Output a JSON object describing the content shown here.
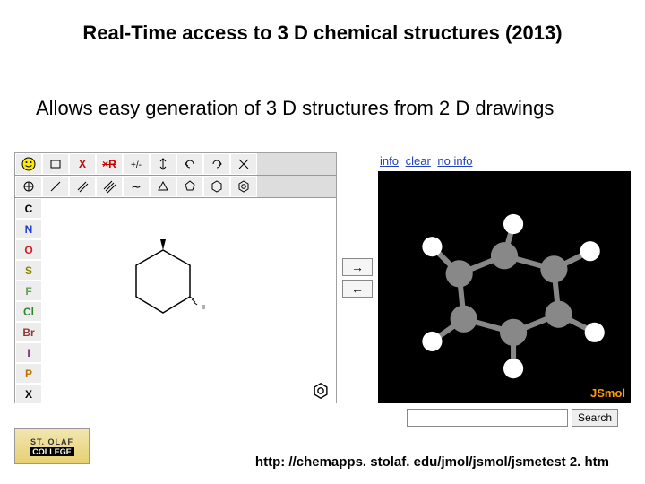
{
  "title": "Real-Time access to 3 D chemical structures (2013)",
  "subtitle": "Allows easy generation of 3 D structures from 2 D drawings",
  "jsme": {
    "toolbar_row1": [
      "smile",
      "rect",
      "X",
      "xR",
      "charge",
      "updown",
      "undo",
      "redo",
      "close"
    ],
    "toolbar_row2": [
      "stereo",
      "bond1",
      "bond2",
      "bond3",
      "tilde",
      "triangle",
      "pentagon",
      "hexagon",
      "benzene"
    ],
    "elements": [
      "C",
      "N",
      "O",
      "S",
      "F",
      "Cl",
      "Br",
      "I",
      "P",
      "X"
    ],
    "drawing_label": "cyclohexane-wedge"
  },
  "arrows": {
    "right": "→",
    "left": "←"
  },
  "jsmol": {
    "links": [
      "info",
      "clear",
      "no info"
    ],
    "brand": "JSmol"
  },
  "search": {
    "placeholder": "",
    "button": "Search"
  },
  "logo": {
    "line1": "ST. OLAF",
    "line2": "COLLEGE"
  },
  "url": "http: //chemapps. stolaf. edu/jmol/jsmol/jsmetest 2. htm"
}
